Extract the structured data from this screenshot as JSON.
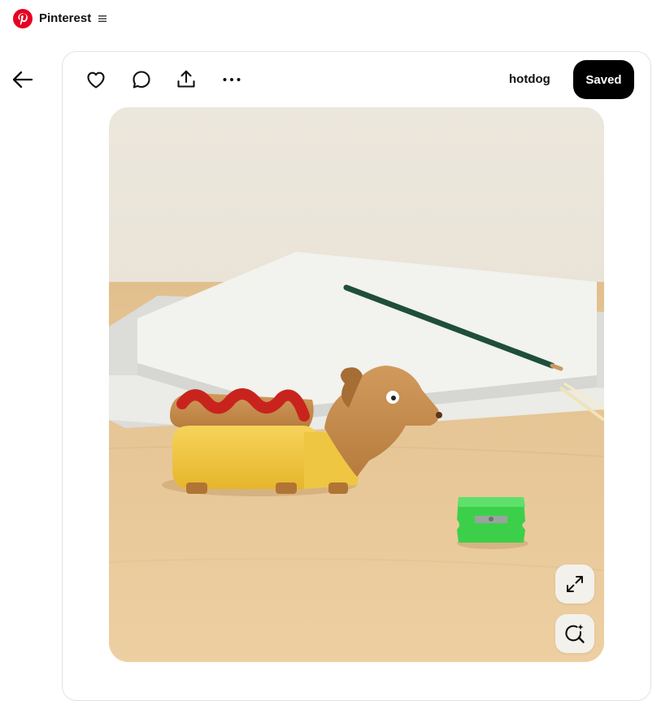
{
  "app": {
    "brand": "Pinterest",
    "brand_color": "#e60023"
  },
  "icons": {
    "logo": "pinterest-logo",
    "menu": "menu-icon",
    "back": "arrow-left-icon",
    "like": "heart-icon",
    "comment": "comment-icon",
    "share": "share-icon",
    "more": "more-icon",
    "expand": "expand-icon",
    "visual_search": "visual-search-icon"
  },
  "pin": {
    "board_name": "hotdog",
    "save_label": "Saved",
    "save_color": "#000000"
  }
}
